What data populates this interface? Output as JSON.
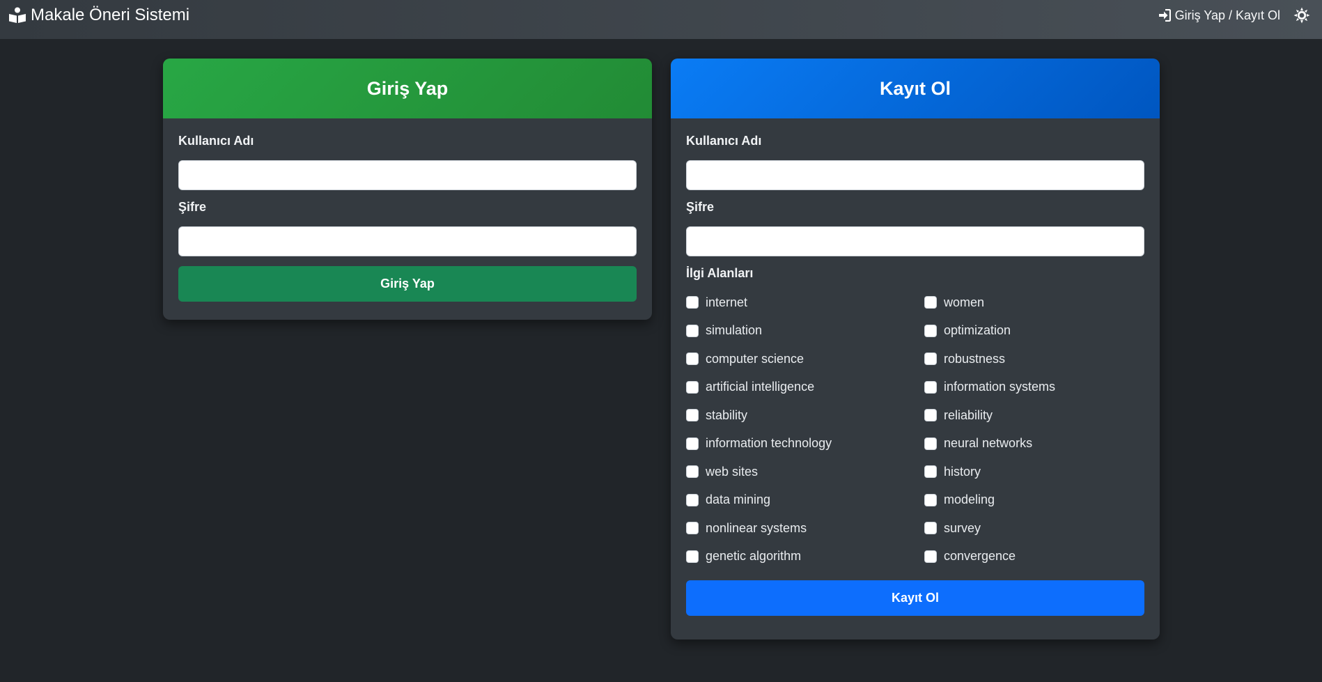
{
  "navbar": {
    "brand": "Makale Öneri Sistemi",
    "brand_icon": "book-reader-icon",
    "auth_link": "Giriş Yap / Kayıt Ol",
    "auth_icon": "sign-in-icon",
    "theme_icon": "sun-icon"
  },
  "login": {
    "title": "Giriş Yap",
    "username_label": "Kullanıcı Adı",
    "username_value": "",
    "password_label": "Şifre",
    "password_value": "",
    "submit_label": "Giriş Yap"
  },
  "register": {
    "title": "Kayıt Ol",
    "username_label": "Kullanıcı Adı",
    "username_value": "",
    "password_label": "Şifre",
    "password_value": "",
    "interests_label": "İlgi Alanları",
    "interests": [
      {
        "label": "internet",
        "checked": false
      },
      {
        "label": "women",
        "checked": false
      },
      {
        "label": "simulation",
        "checked": false
      },
      {
        "label": "optimization",
        "checked": false
      },
      {
        "label": "computer science",
        "checked": false
      },
      {
        "label": "robustness",
        "checked": false
      },
      {
        "label": "artificial intelligence",
        "checked": false
      },
      {
        "label": "information systems",
        "checked": false
      },
      {
        "label": "stability",
        "checked": false
      },
      {
        "label": "reliability",
        "checked": false
      },
      {
        "label": "information technology",
        "checked": false
      },
      {
        "label": "neural networks",
        "checked": false
      },
      {
        "label": "web sites",
        "checked": false
      },
      {
        "label": "history",
        "checked": false
      },
      {
        "label": "data mining",
        "checked": false
      },
      {
        "label": "modeling",
        "checked": false
      },
      {
        "label": "nonlinear systems",
        "checked": false
      },
      {
        "label": "survey",
        "checked": false
      },
      {
        "label": "genetic algorithm",
        "checked": false
      },
      {
        "label": "convergence",
        "checked": false
      }
    ],
    "submit_label": "Kayıt Ol"
  },
  "colors": {
    "login_accent": "#198754",
    "register_accent": "#0d6efd",
    "background": "#212529",
    "card": "#343a40"
  }
}
